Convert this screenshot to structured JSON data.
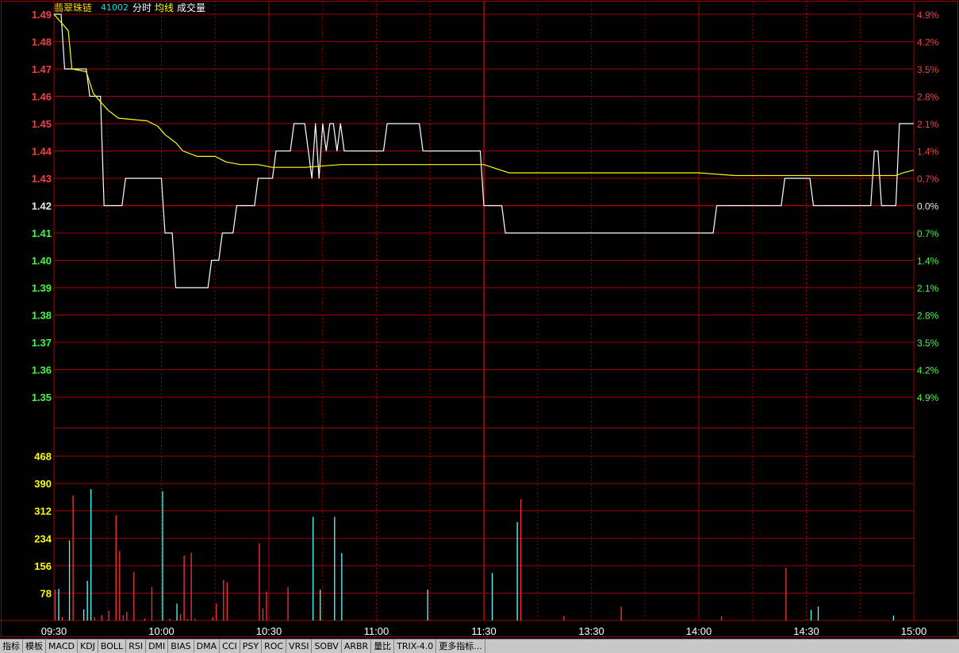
{
  "header": {
    "name": "翡翠珠链",
    "code": "41002",
    "label_time": "分时",
    "label_avg": "均线",
    "label_vol": "成交量"
  },
  "chart_data": {
    "type": "line",
    "price_axis": {
      "ticks": [
        "1.49",
        "1.48",
        "1.47",
        "1.46",
        "1.45",
        "1.44",
        "1.43",
        "1.42",
        "1.41",
        "1.40",
        "1.39",
        "1.38",
        "1.37",
        "1.36",
        "1.35"
      ],
      "pct_ticks": [
        "4.9%",
        "4.2%",
        "3.5%",
        "2.8%",
        "2.1%",
        "1.4%",
        "0.7%",
        "0.0%",
        "0.7%",
        "1.4%",
        "2.1%",
        "2.8%",
        "3.5%",
        "4.2%",
        "4.9%"
      ],
      "ylim": [
        1.35,
        1.49
      ],
      "prev_close": 1.42
    },
    "volume_axis": {
      "ticks": [
        "468",
        "390",
        "312",
        "234",
        "156",
        "78"
      ],
      "ylim": [
        0,
        546
      ]
    },
    "time_axis": {
      "ticks": [
        "09:30",
        "10:00",
        "10:30",
        "11:00",
        "11:30",
        "13:30",
        "14:00",
        "14:30",
        "15:00"
      ],
      "minutes": 240
    },
    "series": [
      {
        "kind": "price",
        "points": [
          [
            0,
            1.49
          ],
          [
            2,
            1.49
          ],
          [
            3,
            1.47
          ],
          [
            9,
            1.47
          ],
          [
            10,
            1.46
          ],
          [
            13,
            1.46
          ],
          [
            14,
            1.42
          ],
          [
            19,
            1.42
          ],
          [
            20,
            1.43
          ],
          [
            30,
            1.43
          ],
          [
            31,
            1.41
          ],
          [
            33,
            1.41
          ],
          [
            34,
            1.39
          ],
          [
            43,
            1.39
          ],
          [
            44,
            1.4
          ],
          [
            46,
            1.4
          ],
          [
            47,
            1.41
          ],
          [
            50,
            1.41
          ],
          [
            51,
            1.42
          ],
          [
            56,
            1.42
          ],
          [
            57,
            1.43
          ],
          [
            61,
            1.43
          ],
          [
            62,
            1.44
          ],
          [
            66,
            1.44
          ],
          [
            67,
            1.45
          ],
          [
            70,
            1.45
          ],
          [
            71,
            1.44
          ],
          [
            72,
            1.43
          ],
          [
            73,
            1.45
          ],
          [
            74,
            1.43
          ],
          [
            75,
            1.45
          ],
          [
            76,
            1.44
          ],
          [
            77,
            1.45
          ],
          [
            78,
            1.45
          ],
          [
            79,
            1.44
          ],
          [
            80,
            1.45
          ],
          [
            81,
            1.44
          ],
          [
            92,
            1.44
          ],
          [
            93,
            1.45
          ],
          [
            102,
            1.45
          ],
          [
            103,
            1.44
          ],
          [
            119,
            1.44
          ],
          [
            120,
            1.42
          ],
          [
            125,
            1.42
          ],
          [
            126,
            1.41
          ],
          [
            184,
            1.41
          ],
          [
            185,
            1.42
          ],
          [
            203,
            1.42
          ],
          [
            204,
            1.43
          ],
          [
            211,
            1.43
          ],
          [
            212,
            1.42
          ],
          [
            228,
            1.42
          ],
          [
            229,
            1.44
          ],
          [
            230,
            1.44
          ],
          [
            231,
            1.42
          ],
          [
            235,
            1.42
          ],
          [
            236,
            1.45
          ],
          [
            240,
            1.45
          ]
        ]
      },
      {
        "kind": "average",
        "points": [
          [
            0,
            1.49
          ],
          [
            4,
            1.484
          ],
          [
            5,
            1.47
          ],
          [
            9,
            1.469
          ],
          [
            11,
            1.461
          ],
          [
            15,
            1.455
          ],
          [
            18,
            1.452
          ],
          [
            26,
            1.451
          ],
          [
            29,
            1.449
          ],
          [
            31,
            1.446
          ],
          [
            34,
            1.443
          ],
          [
            36,
            1.44
          ],
          [
            40,
            1.438
          ],
          [
            45,
            1.438
          ],
          [
            48,
            1.436
          ],
          [
            52,
            1.435
          ],
          [
            57,
            1.435
          ],
          [
            61,
            1.434
          ],
          [
            70,
            1.434
          ],
          [
            80,
            1.435
          ],
          [
            100,
            1.435
          ],
          [
            119,
            1.435
          ],
          [
            120,
            1.435
          ],
          [
            127,
            1.432
          ],
          [
            130,
            1.432
          ],
          [
            160,
            1.432
          ],
          [
            180,
            1.432
          ],
          [
            190,
            1.431
          ],
          [
            235,
            1.431
          ],
          [
            237,
            1.432
          ],
          [
            240,
            1.433
          ]
        ]
      }
    ],
    "volume": [
      [
        0,
        88,
        "up"
      ],
      [
        1,
        90,
        "down"
      ],
      [
        2,
        10,
        "up"
      ],
      [
        4,
        228,
        "down"
      ],
      [
        5,
        356,
        "up"
      ],
      [
        8,
        32,
        "down"
      ],
      [
        9,
        113,
        "down"
      ],
      [
        10,
        374,
        "down"
      ],
      [
        11,
        10,
        "up"
      ],
      [
        13,
        15,
        "up"
      ],
      [
        15,
        28,
        "up"
      ],
      [
        17,
        300,
        "up"
      ],
      [
        18,
        198,
        "up"
      ],
      [
        19,
        15,
        "up"
      ],
      [
        20,
        25,
        "up"
      ],
      [
        22,
        138,
        "up"
      ],
      [
        25,
        6,
        "up"
      ],
      [
        27,
        95,
        "up"
      ],
      [
        30,
        368,
        "down"
      ],
      [
        32,
        5,
        "up"
      ],
      [
        34,
        48,
        "down"
      ],
      [
        35,
        18,
        "up"
      ],
      [
        36,
        185,
        "up"
      ],
      [
        37,
        4,
        "up"
      ],
      [
        38,
        193,
        "up"
      ],
      [
        39,
        5,
        "up"
      ],
      [
        44,
        10,
        "up"
      ],
      [
        45,
        48,
        "up"
      ],
      [
        47,
        115,
        "up"
      ],
      [
        48,
        108,
        "up"
      ],
      [
        57,
        220,
        "up"
      ],
      [
        58,
        35,
        "up"
      ],
      [
        59,
        82,
        "up"
      ],
      [
        65,
        95,
        "up"
      ],
      [
        72,
        295,
        "down"
      ],
      [
        74,
        88,
        "down"
      ],
      [
        78,
        295,
        "down"
      ],
      [
        80,
        192,
        "down"
      ],
      [
        104,
        88,
        "down"
      ],
      [
        122,
        135,
        "down"
      ],
      [
        129,
        280,
        "down"
      ],
      [
        130,
        345,
        "up"
      ],
      [
        142,
        13,
        "up"
      ],
      [
        158,
        40,
        "up"
      ],
      [
        186,
        12,
        "up"
      ],
      [
        204,
        150,
        "up"
      ],
      [
        211,
        30,
        "down"
      ],
      [
        213,
        40,
        "down"
      ],
      [
        234,
        14,
        "down"
      ]
    ],
    "grid": true
  },
  "tabs": [
    "指标",
    "模板",
    "MACD",
    "KDJ",
    "BOLL",
    "RSI",
    "DMI",
    "BIAS",
    "DMA",
    "CCI",
    "PSY",
    "ROC",
    "VRSI",
    "SOBV",
    "ARBR",
    "量比",
    "TRIX-4.0",
    "更多指标..."
  ]
}
